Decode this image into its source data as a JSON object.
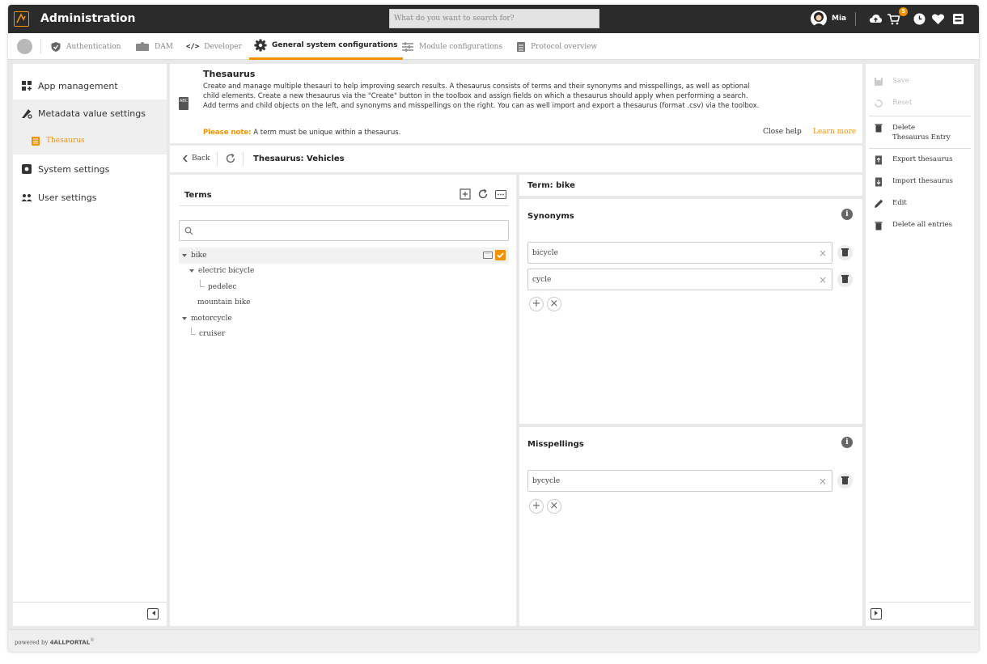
{
  "app": {
    "title": "Administration",
    "brand_color": "#f39200"
  },
  "search": {
    "placeholder": "What do you want to search for?"
  },
  "user": {
    "name": "Mia",
    "cart_count": "5"
  },
  "tabs": [
    {
      "label": "Authentication"
    },
    {
      "label": "DAM"
    },
    {
      "label": "Developer"
    },
    {
      "label": "General system configurations"
    },
    {
      "label": "Module configurations"
    },
    {
      "label": "Protocol overview"
    }
  ],
  "sidebar": {
    "items": [
      {
        "label": "App management"
      },
      {
        "label": "Metadata value settings"
      },
      {
        "label": "Thesaurus"
      },
      {
        "label": "System settings"
      },
      {
        "label": "User settings"
      }
    ]
  },
  "help": {
    "title": "Thesaurus",
    "icon_text": "ABC",
    "text": "Create and manage multiple thesauri to help improving search results. A thesaurus consists of terms and their synonyms and misspellings, as well as optional child elements. Create a new thesaurus via the \"Create\" button in the toolbox and assign fields on which a thesaurus should apply when performing a search. Add terms and child objects on the left, and synonyms and misspellings on the right. You can as well import and export a thesaurus (format .csv) via the toolbox.",
    "note_label": "Please note:",
    "note_text": "A term must be unique within a thesaurus.",
    "close_label": "Close help",
    "learn_more_label": "Learn more"
  },
  "header": {
    "back_label": "Back",
    "title": "Thesaurus:  Vehicles"
  },
  "terms": {
    "title": "Terms",
    "more_glyph": "···",
    "tree": [
      {
        "label": "bike"
      },
      {
        "label": "electric bicycle"
      },
      {
        "label": "pedelec"
      },
      {
        "label": "mountain bike"
      },
      {
        "label": "motorcycle"
      },
      {
        "label": "cruiser"
      }
    ]
  },
  "term": {
    "title": "Term:  bike",
    "synonyms_title": "Synonyms",
    "synonyms": [
      {
        "value": "bicycle"
      },
      {
        "value": "cycle"
      }
    ],
    "misspellings_title": "Misspellings",
    "misspellings": [
      {
        "value": "bycycle"
      }
    ],
    "info_glyph": "i",
    "clear_glyph": "×",
    "add_glyph": "+"
  },
  "toolbox": {
    "save": "Save",
    "reset": "Reset",
    "delete_entry": "Delete Thesaurus Entry",
    "export": "Export thesaurus",
    "import": "Import thesaurus",
    "edit": "Edit",
    "delete_all": "Delete all entries"
  },
  "footer": {
    "prefix": "powered by ",
    "brand": "4ALLPORTAL",
    "mark": "©"
  }
}
